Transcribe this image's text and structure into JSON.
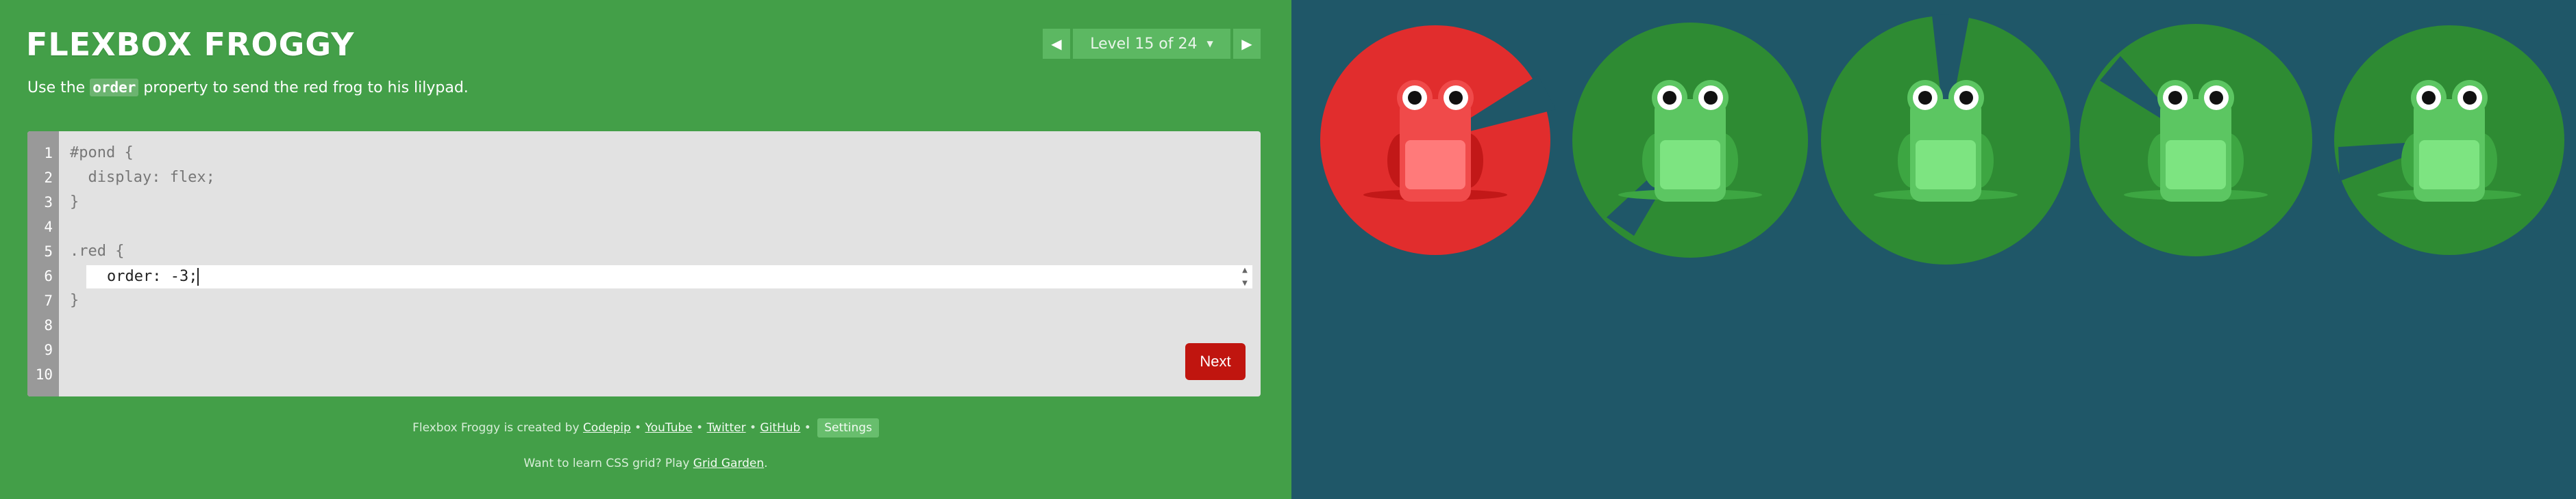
{
  "app": {
    "title": "FLEXBOX FROGGY"
  },
  "level_nav": {
    "label": "Level 15 of 24",
    "prev_icon": "triangle-left-icon",
    "next_icon": "triangle-right-icon"
  },
  "instructions": {
    "prefix": "Use the ",
    "code": "order",
    "suffix": " property to send the red frog to his lilypad."
  },
  "editor": {
    "line_numbers": [
      "1",
      "2",
      "3",
      "4",
      "5",
      "6",
      "7",
      "8",
      "9",
      "10"
    ],
    "lines_before": [
      "#pond {",
      "  display: flex;",
      "}",
      "",
      ".red {"
    ],
    "input_value": "order: -3;",
    "lines_after": [
      "}"
    ]
  },
  "next_button": {
    "label": "Next"
  },
  "credits": {
    "text": "Flexbox Froggy is created by",
    "links": [
      "Codepip",
      "YouTube",
      "Twitter",
      "GitHub"
    ],
    "sep": "•",
    "settings": "Settings"
  },
  "grid_promo": {
    "text": "Want to learn CSS grid? Play",
    "link": "Grid Garden",
    "end": "."
  },
  "pond": {
    "frogs": [
      "red",
      "green",
      "green",
      "green",
      "green"
    ]
  },
  "colors": {
    "sidebar": "#439f48",
    "pond": "#1f5768",
    "next_button": "#c0150f",
    "red_pad": "#e12d2d",
    "green_pad": "#2e8b33"
  }
}
